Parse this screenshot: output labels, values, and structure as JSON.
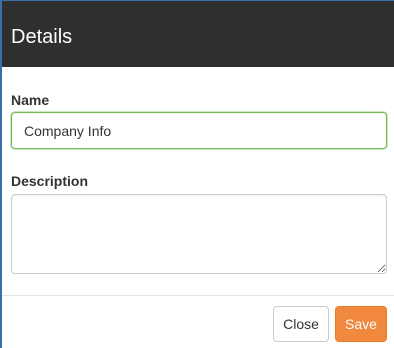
{
  "dialog": {
    "title": "Details"
  },
  "form": {
    "name_label": "Name",
    "name_value": "Company Info",
    "description_label": "Description",
    "description_value": ""
  },
  "footer": {
    "close_label": "Close",
    "save_label": "Save"
  },
  "colors": {
    "header_bg": "#2f2f2f",
    "focus_border": "#76b852",
    "save_button": "#f0883e"
  }
}
